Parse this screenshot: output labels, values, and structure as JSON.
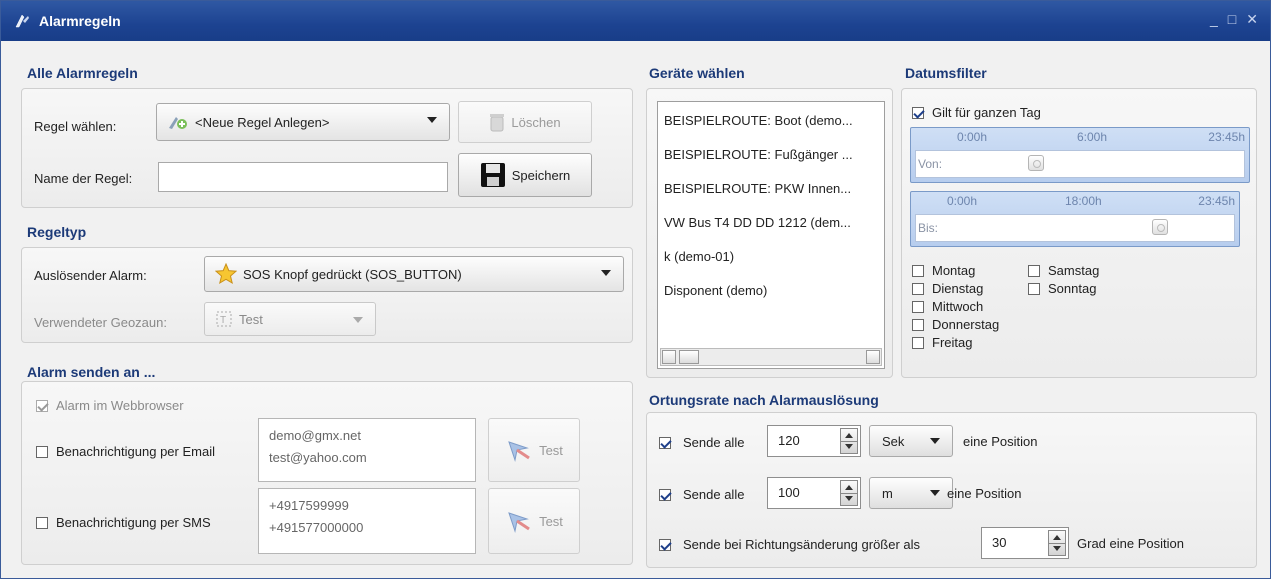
{
  "window": {
    "title": "Alarmregeln",
    "controls": {
      "minimize": "_",
      "maximize": "□",
      "close": "✕"
    }
  },
  "alle_alarmregeln": {
    "title": "Alle Alarmregeln",
    "regel_label": "Regel wählen:",
    "regel_value": "<Neue Regel Anlegen>",
    "loeschen_label": "Löschen",
    "name_label": "Name der Regel:",
    "name_value": "",
    "speichern_label": "Speichern"
  },
  "regeltyp": {
    "title": "Regeltyp",
    "ausloesend_label": "Auslösender Alarm:",
    "ausloesend_value": "SOS Knopf gedrückt (SOS_BUTTON)",
    "geozaun_label": "Verwendeter Geozaun:",
    "geozaun_value": "Test"
  },
  "alarm_senden": {
    "title": "Alarm senden an ...",
    "webbrowser_label": "Alarm im Webbrowser",
    "webbrowser_checked": true,
    "email_label": "Benachrichtigung per Email",
    "email_checked": false,
    "email_lines": [
      "demo@gmx.net",
      "test@yahoo.com"
    ],
    "email_test": "Test",
    "sms_label": "Benachrichtigung per SMS",
    "sms_checked": false,
    "sms_lines": [
      "+4917599999",
      "+491577000000"
    ],
    "sms_test": "Test"
  },
  "geraete": {
    "title": "Geräte wählen",
    "items": [
      "BEISPIELROUTE: Boot (demo...",
      "BEISPIELROUTE: Fußgänger ...",
      "BEISPIELROUTE: PKW Innen...",
      "VW Bus T4 DD DD 1212 (dem...",
      "k (demo-01)",
      "Disponent (demo)"
    ]
  },
  "datumsfilter": {
    "title": "Datumsfilter",
    "ganzer_tag_label": "Gilt für ganzen Tag",
    "ganzer_tag_checked": true,
    "von": {
      "ticks": [
        "0:00h",
        "6:00h",
        "23:45h"
      ],
      "label": "Von:"
    },
    "bis": {
      "ticks": [
        "0:00h",
        "18:00h",
        "23:45h"
      ],
      "label": "Bis:"
    },
    "days_left": [
      {
        "label": "Montag",
        "checked": false
      },
      {
        "label": "Dienstag",
        "checked": false
      },
      {
        "label": "Mittwoch",
        "checked": false
      },
      {
        "label": "Donnerstag",
        "checked": false
      },
      {
        "label": "Freitag",
        "checked": false
      }
    ],
    "days_right": [
      {
        "label": "Samstag",
        "checked": false
      },
      {
        "label": "Sonntag",
        "checked": false
      }
    ]
  },
  "ortungsrate": {
    "title": "Ortungsrate nach Alarmauslösung",
    "row1": {
      "label": "Sende alle",
      "value": "120",
      "unit": "Sek",
      "suffix": "eine Position",
      "checked": true
    },
    "row2": {
      "label": "Sende alle",
      "value": "100",
      "unit": "m",
      "suffix": "eine Position",
      "checked": true
    },
    "row3": {
      "label": "Sende bei Richtungsänderung größer als",
      "value": "30",
      "suffix": "Grad eine Position",
      "checked": true
    }
  }
}
